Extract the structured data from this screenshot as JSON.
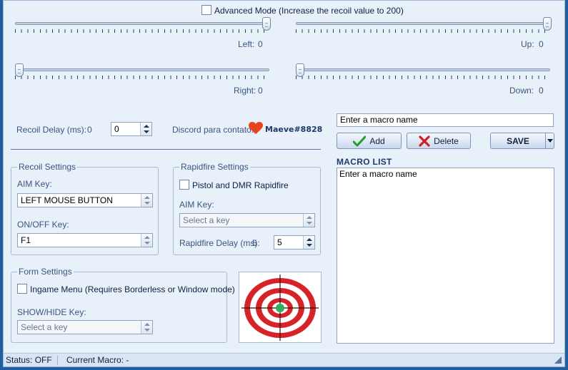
{
  "advanced_mode": {
    "label": "Advanced Mode (Increase the recoil value to 200)",
    "checked": false
  },
  "sliders": {
    "left": {
      "label": "Left:",
      "value": "0"
    },
    "up": {
      "label": "Up:",
      "value": "0"
    },
    "right": {
      "label": "Right:",
      "value": "0"
    },
    "down": {
      "label": "Down:",
      "value": "0"
    }
  },
  "recoil_delay": {
    "label": "Recoil Delay (ms):",
    "value_text": "0",
    "input_value": "0"
  },
  "discord": {
    "label": "Discord para contato:",
    "handle": "Maeve#8828",
    "heart_color": "#e8431c"
  },
  "recoil_settings": {
    "title": "Recoil Settings",
    "aim_key_label": "AIM Key:",
    "aim_key_value": "LEFT MOUSE BUTTON",
    "onoff_key_label": "ON/OFF Key:",
    "onoff_key_value": "F1"
  },
  "rapidfire_settings": {
    "title": "Rapidfire Settings",
    "pistol_label": "Pistol and DMR Rapidfire",
    "aim_key_label": "AIM Key:",
    "aim_key_placeholder": "Select a key",
    "delay_label": "Rapidfire Delay (ms):",
    "delay_value_text": "5",
    "delay_input": "5"
  },
  "form_settings": {
    "title": "Form Settings",
    "ingame_label": "Ingame Menu (Requires Borderless or Window mode)",
    "showhide_label": "SHOW/HIDE Key:",
    "showhide_placeholder": "Select a key"
  },
  "macro": {
    "name_input": "Enter a macro name",
    "add_label": "Add",
    "delete_label": "Delete",
    "save_label": "SAVE",
    "list_title": "MACRO LIST",
    "list_items": [
      "Enter a macro name"
    ]
  },
  "status": {
    "status_text": "Status: OFF",
    "current_macro": "Current Macro: -"
  },
  "colors": {
    "background": "#e8f0fa",
    "target_red": "#d8222a",
    "target_green": "#2fae5f",
    "add_check": "#1f9e2f",
    "delete_x": "#d11f1f"
  }
}
